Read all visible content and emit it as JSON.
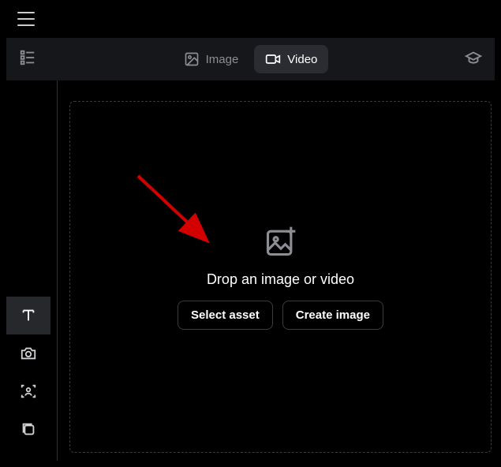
{
  "tabs": {
    "image_label": "Image",
    "video_label": "Video"
  },
  "dropzone": {
    "text": "Drop an image or video",
    "select_label": "Select asset",
    "create_label": "Create image"
  },
  "sidebar": {
    "items": [
      {
        "name": "text-tool",
        "active": true
      },
      {
        "name": "camera-tool",
        "active": false
      },
      {
        "name": "face-tool",
        "active": false
      },
      {
        "name": "layers-tool",
        "active": false
      }
    ]
  }
}
